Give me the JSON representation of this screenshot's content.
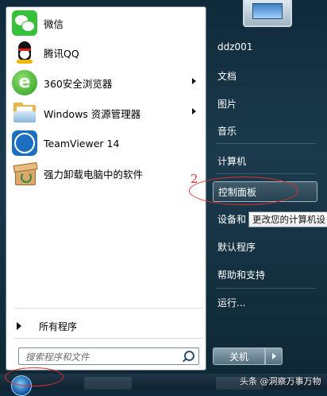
{
  "programs": [
    {
      "label": "微信",
      "icon": "wechat-icon",
      "has_submenu": false
    },
    {
      "label": "腾讯QQ",
      "icon": "qq-penguin-icon",
      "has_submenu": false
    },
    {
      "label": "360安全浏览器",
      "icon": "360-browser-icon",
      "has_submenu": true
    },
    {
      "label": "Windows 资源管理器",
      "icon": "windows-explorer-folder-icon",
      "has_submenu": true
    },
    {
      "label": "TeamViewer 14",
      "icon": "teamviewer-icon",
      "has_submenu": false
    },
    {
      "label": "强力卸载电脑中的软件",
      "icon": "uninstall-box-icon",
      "has_submenu": false
    }
  ],
  "all_programs_label": "所有程序",
  "search": {
    "placeholder": "搜索程序和文件",
    "value": ""
  },
  "right_items": [
    {
      "label": "ddz001"
    },
    {
      "label": "文档"
    },
    {
      "label": "图片"
    },
    {
      "label": "音乐"
    },
    {
      "label": "计算机"
    },
    {
      "label": "控制面板",
      "highlighted": true
    },
    {
      "label": "设备和"
    },
    {
      "label": "默认程序"
    },
    {
      "label": "帮助和支持"
    },
    {
      "label": "运行..."
    }
  ],
  "tooltip": "更改您的计算机设",
  "shutdown_label": "关机",
  "annotation_number": "2",
  "watermark": "头条 @洞察万事万物",
  "colors": {
    "annotation": "#e0302a",
    "menu_bg_left": "#ffffff",
    "desktop_bg": "#1b3b4d"
  }
}
